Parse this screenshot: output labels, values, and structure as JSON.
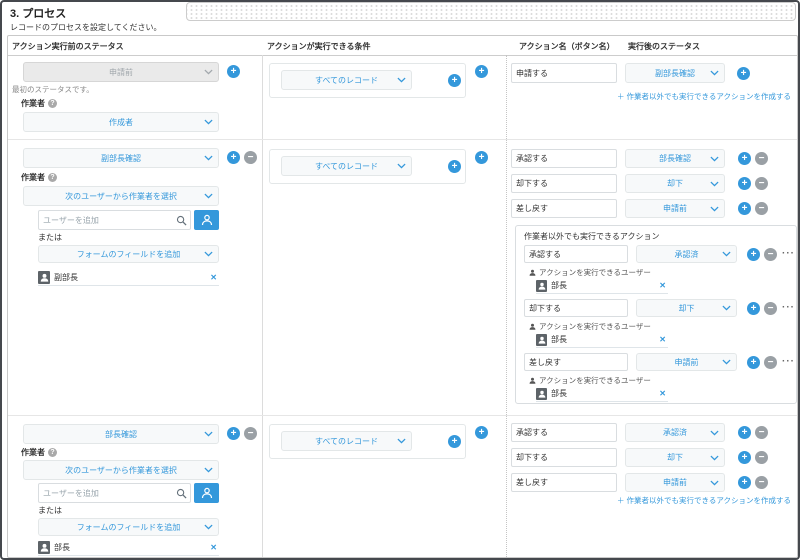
{
  "page": {
    "title": "3. プロセス",
    "description": "レコードのプロセスを設定してください。"
  },
  "table": {
    "headers": [
      "アクション実行前のステータス",
      "アクションが実行できる条件",
      "アクション名（ボタン名）",
      "実行後のステータス"
    ]
  },
  "labels": {
    "assignee": "作業者",
    "help": "?",
    "first_status_note": "最初のステータスです。",
    "or": "または",
    "all_records": "すべてのレコード",
    "user_add_placeholder": "ユーザーを追加",
    "non_worker_box_title": "作業者以外でも実行できるアクション",
    "executable_users": "アクションを実行できるユーザー",
    "create_non_worker_action": "＋ 作業者以外でも実行できるアクションを作成する",
    "plus": "+",
    "minus": "−",
    "more": "···",
    "close": "✕"
  },
  "statuses": {
    "row1": {
      "status": "申請前",
      "assignee": "作成者"
    },
    "row2": {
      "status": "副部長確認",
      "assignee_type": "次のユーザーから作業者を選択",
      "form_field_source": "フォームのフィールドを追加",
      "form_field_user": "副部長"
    },
    "row3": {
      "status": "部長確認",
      "assignee_type": "次のユーザーから作業者を選択",
      "form_field_source": "フォームのフィールドを追加",
      "form_field_user": "部長"
    }
  },
  "actions": {
    "row1": [
      {
        "name": "申請する",
        "next_status": "副部長確認"
      }
    ],
    "row2": [
      {
        "name": "承認する",
        "next_status": "部長確認"
      },
      {
        "name": "却下する",
        "next_status": "却下"
      },
      {
        "name": "差し戻す",
        "next_status": "申請前"
      }
    ],
    "row2_non_worker": [
      {
        "name": "承認する",
        "next_status": "承認済",
        "user": "部長"
      },
      {
        "name": "却下する",
        "next_status": "却下",
        "user": "部長"
      },
      {
        "name": "差し戻す",
        "next_status": "申請前",
        "user": "部長"
      }
    ],
    "row3": [
      {
        "name": "承認する",
        "next_status": "承認済"
      },
      {
        "name": "却下する",
        "next_status": "却下"
      },
      {
        "name": "差し戻す",
        "next_status": "申請前"
      }
    ]
  },
  "colors": {
    "accent_blue": "#3498db",
    "minus_gray": "#9aa0a5",
    "disabled_bg": "#eaeaea"
  }
}
